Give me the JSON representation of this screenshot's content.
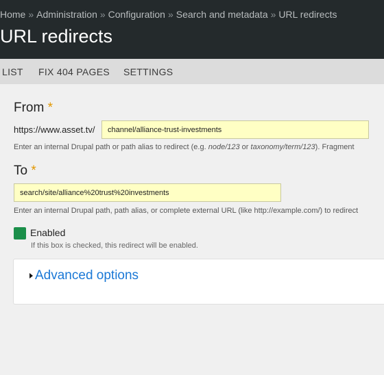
{
  "breadcrumb": {
    "items": [
      "Home",
      "Administration",
      "Configuration",
      "Search and metadata",
      "URL redirects"
    ],
    "separator": "»"
  },
  "page_title": "URL redirects",
  "tabs": [
    {
      "label": "LIST"
    },
    {
      "label": "FIX 404 PAGES"
    },
    {
      "label": "SETTINGS"
    }
  ],
  "from": {
    "label": "From",
    "required_mark": "*",
    "prefix": "https://www.asset.tv/",
    "value": "channel/alliance-trust-investments",
    "desc_1": "Enter an internal Drupal path or path alias to redirect (e.g. ",
    "desc_em_1": "node/123",
    "desc_2": " or ",
    "desc_em_2": "taxonomy/term/123",
    "desc_3": "). Fragment"
  },
  "to": {
    "label": "To",
    "required_mark": "*",
    "value": "search/site/alliance%20trust%20investments",
    "desc": "Enter an internal Drupal path, path alias, or complete external URL (like http://example.com/) to redirect"
  },
  "enabled": {
    "label": "Enabled",
    "desc": "If this box is checked, this redirect will be enabled.",
    "checked": true
  },
  "advanced": {
    "label": "Advanced options"
  },
  "colors": {
    "header_bg": "#242a2c",
    "field_bg": "#ffffc4",
    "required": "#e29700",
    "checkbox": "#1b8f4a",
    "link": "#1a78d6"
  }
}
